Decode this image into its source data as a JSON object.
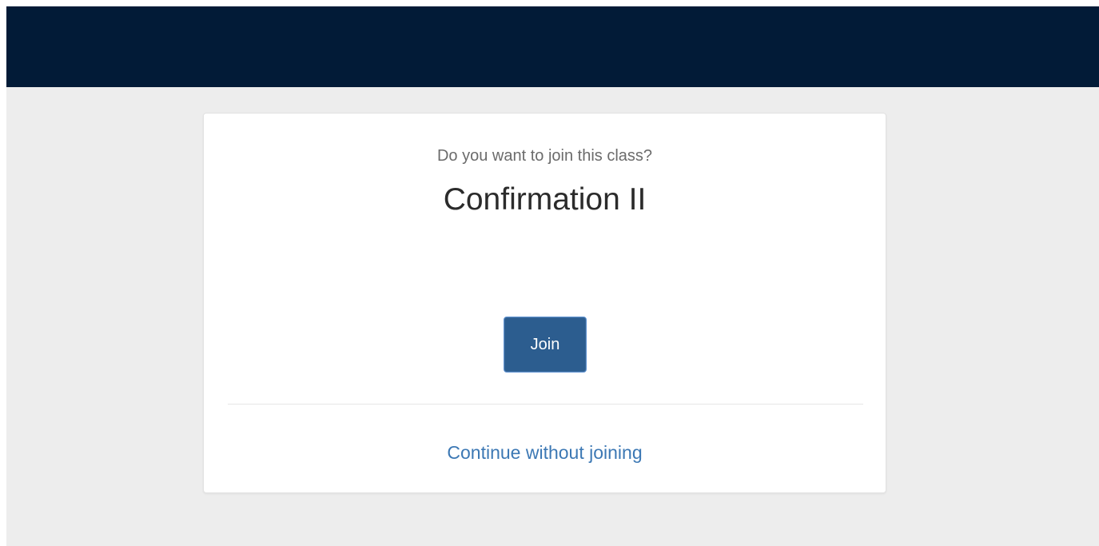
{
  "header": {
    "background_color": "#021b37"
  },
  "dialog": {
    "prompt": "Do you want to join this class?",
    "class_name": "Confirmation II",
    "join_label": "Join",
    "continue_label": "Continue without joining",
    "accent_color": "#2c5d8f",
    "link_color": "#3c78b4"
  }
}
